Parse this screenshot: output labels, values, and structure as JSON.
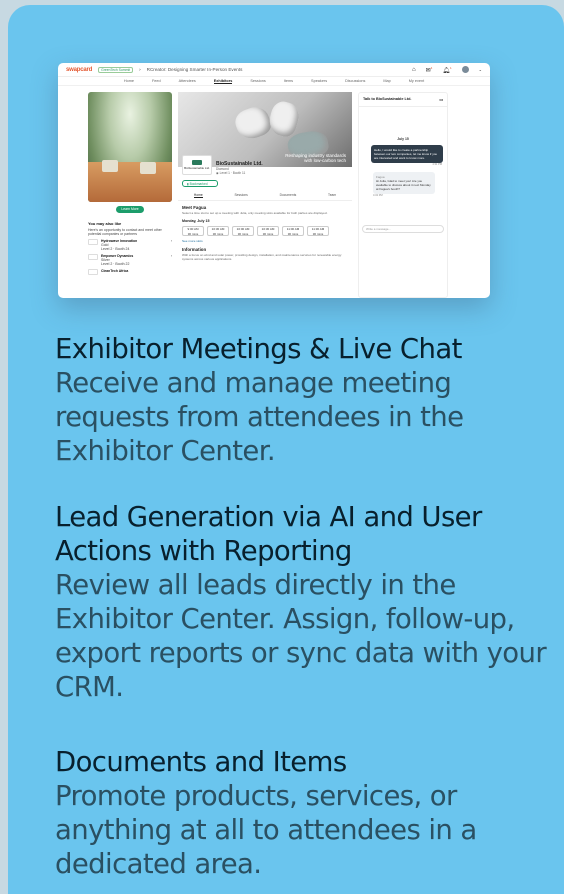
{
  "shot": {
    "logo": "swapcard",
    "brand": "GreenTech Summit",
    "crumb": "RCreator: Designing Smarter In-Person Events",
    "badge_counts": [
      "4",
      "1"
    ],
    "user": "Me",
    "nav": [
      "Home",
      "Feed",
      "Attendees",
      "Exhibitors",
      "Sessions",
      "Items",
      "Speakers",
      "Discussions",
      "Map",
      "My event"
    ],
    "learn_more": "Learn More",
    "may_like_title": "You may also like",
    "may_like_desc": "Here's an opportunity to contact and meet other potential companies or partners",
    "may_like_items": [
      {
        "name": "Hydrowave Innovation",
        "sub": "Gold",
        "loc": "Level 2 · Booth 24"
      },
      {
        "name": "Empower Dynamics",
        "sub": "Silver",
        "loc": "Level 2 · Booth 22"
      },
      {
        "name": "CleanTech Africa",
        "sub": "",
        "loc": ""
      }
    ],
    "hero_caption_1": "Reshaping industry standards",
    "hero_caption_2": "with low-carbon tech",
    "company_logo_text": "BioSustainable Ltd.",
    "company_name": "BioSustainable Ltd.",
    "company_tier": "Diamond",
    "company_loc": "Level 1 · Booth 11",
    "bookmarked": "Bookmarked",
    "tabs": [
      "Home",
      "Sessions",
      "Documents",
      "Team"
    ],
    "meet_title": "Meet Fagua",
    "meet_desc": "Select a time slot to set up a meeting with Julia, only meeting slots available for both parties are displayed.",
    "meet_day": "Monday, July 15",
    "slots": [
      {
        "t": "9:00 AM",
        "d": "30 mins"
      },
      {
        "t": "10:30 AM",
        "d": "30 mins"
      },
      {
        "t": "10:00 AM",
        "d": "30 mins"
      },
      {
        "t": "10:30 AM",
        "d": "30 mins"
      },
      {
        "t": "11:00 AM",
        "d": "30 mins"
      },
      {
        "t": "11:30 AM",
        "d": "30 mins"
      }
    ],
    "see_more": "See more slots",
    "info_title": "Information",
    "info_desc": "With a focus on wind and solar power, providing design, installation, and maintenance services for renewable energy systems across various applications.",
    "chat_title": "Talk to BioSustainable Ltd.",
    "chat_day": "July 15",
    "chat_msg_1": "Hello, I would like to create a partnership between our two companies, let me know if you are interested and want to know more.",
    "chat_time_1": "4:31 PM",
    "chat_sender": "Fagua",
    "chat_msg_2": "Hi Julia, Glad to meet you! Are you available to discuss about it next Monday at Fagua's booth?",
    "chat_time_2": "4:32 PM",
    "chat_input": "Write a message..."
  },
  "features": [
    {
      "title": "Exhibitor Meetings & Live Chat",
      "desc": "Receive and manage meeting requests from attendees in the Exhibitor Center."
    },
    {
      "title": "Lead Generation via AI and User Actions with Reporting",
      "desc": "Review all leads directly in the Exhibitor Center. Assign, follow-up, export reports or sync data with your CRM."
    },
    {
      "title": "Documents and Items",
      "desc": "Promote products, services, or anything at all to attendees in a dedicated area."
    }
  ]
}
